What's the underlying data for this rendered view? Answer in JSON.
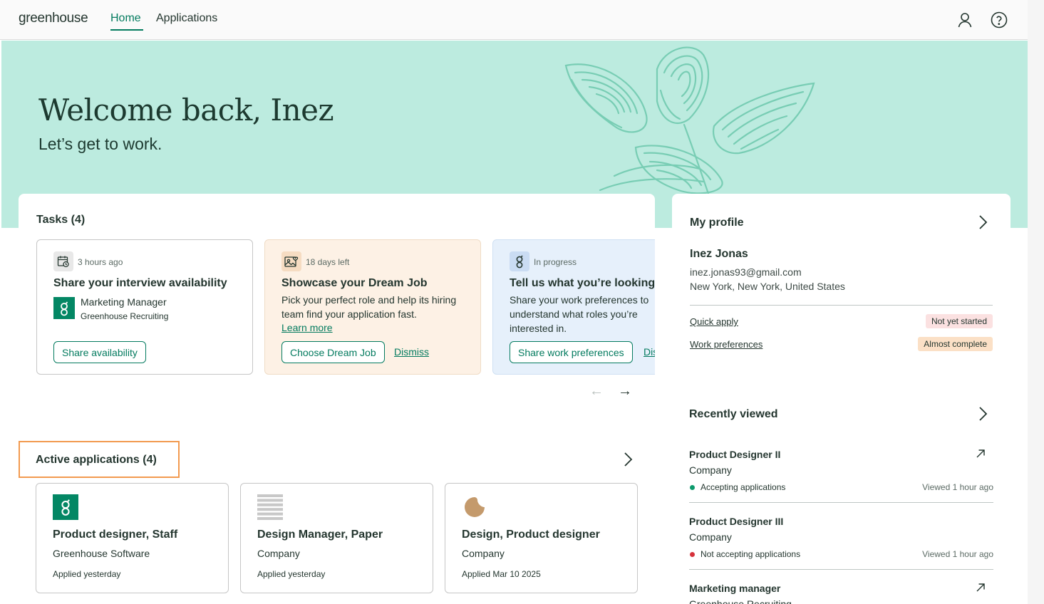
{
  "nav": {
    "logo": "greenhouse",
    "home": "Home",
    "applications": "Applications"
  },
  "hero": {
    "title": "Welcome back, Inez",
    "subtitle": "Let’s get to work."
  },
  "tasks": {
    "title": "Tasks (4)",
    "items": [
      {
        "meta": "3 hours ago",
        "title": "Share your interview availability",
        "role": "Marketing Manager",
        "company": "Greenhouse Recruiting",
        "button": "Share availability"
      },
      {
        "meta": "18 days left",
        "title": "Showcase your Dream Job",
        "description": "Pick your perfect role and help its hiring team find your application fast.",
        "link": "Learn more",
        "button": "Choose Dream Job",
        "dismiss": "Dismiss"
      },
      {
        "meta": "In progress",
        "title": "Tell us what you’re looking",
        "description": "Share your work preferences to understand what roles you’re interested in.",
        "button": "Share work preferences",
        "dismiss": "Dismiss"
      }
    ]
  },
  "active": {
    "title": "Active applications (4)",
    "items": [
      {
        "title": "Product designer, Staff",
        "company": "Greenhouse Software",
        "date": "Applied yesterday"
      },
      {
        "title": "Design Manager, Paper",
        "company": "Company",
        "date": "Applied yesterday"
      },
      {
        "title": "Design, Product designer",
        "company": "Company",
        "date": "Applied Mar 10 2025"
      }
    ]
  },
  "profile": {
    "title": "My profile",
    "name": "Inez Jonas",
    "email": "inez.jonas93@gmail.com",
    "location": "New York, New York, United States",
    "quick_apply": "Quick apply",
    "quick_apply_status": "Not yet started",
    "work_prefs": "Work preferences",
    "work_prefs_status": "Almost complete"
  },
  "recent": {
    "title": "Recently viewed",
    "items": [
      {
        "title": "Product Designer II",
        "company": "Company",
        "status": "Accepting applications",
        "viewed": "Viewed 1 hour ago"
      },
      {
        "title": "Product Designer III",
        "company": "Company",
        "status": "Not accepting applications",
        "viewed": "Viewed 1 hour ago"
      },
      {
        "title": "Marketing manager",
        "company": "Greenhouse Recruiting"
      }
    ]
  },
  "colors": {
    "brand_green": "#047b5f",
    "hero_bg": "#bcebdf",
    "highlight": "#f29a4f",
    "accepting_dot": "#0d9a6c",
    "not_accepting_dot": "#d6323b"
  }
}
